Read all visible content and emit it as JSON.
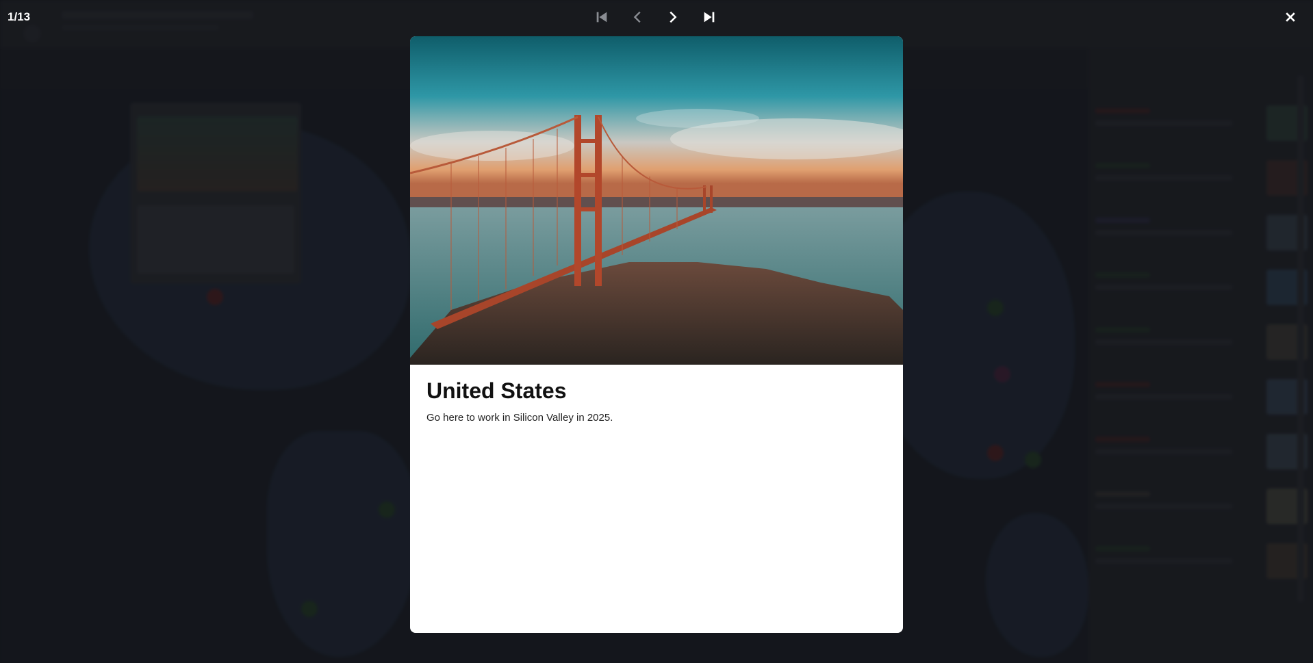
{
  "lightbox": {
    "counter": "1/13",
    "nav": {
      "first_icon": "skip-to-first-icon",
      "prev_icon": "chevron-left-icon",
      "next_icon": "chevron-right-icon",
      "last_icon": "skip-to-last-icon",
      "close_icon": "close-icon"
    },
    "card": {
      "title": "United States",
      "description": "Go here to work in Silicon Valley in 2025.",
      "photo_icon": "golden-gate-bridge-photo"
    }
  },
  "colors": {
    "overlay": "#0f1115",
    "card_background": "#ffffff",
    "icon_active": "#ffffff",
    "icon_disabled": "#8a8d93"
  }
}
